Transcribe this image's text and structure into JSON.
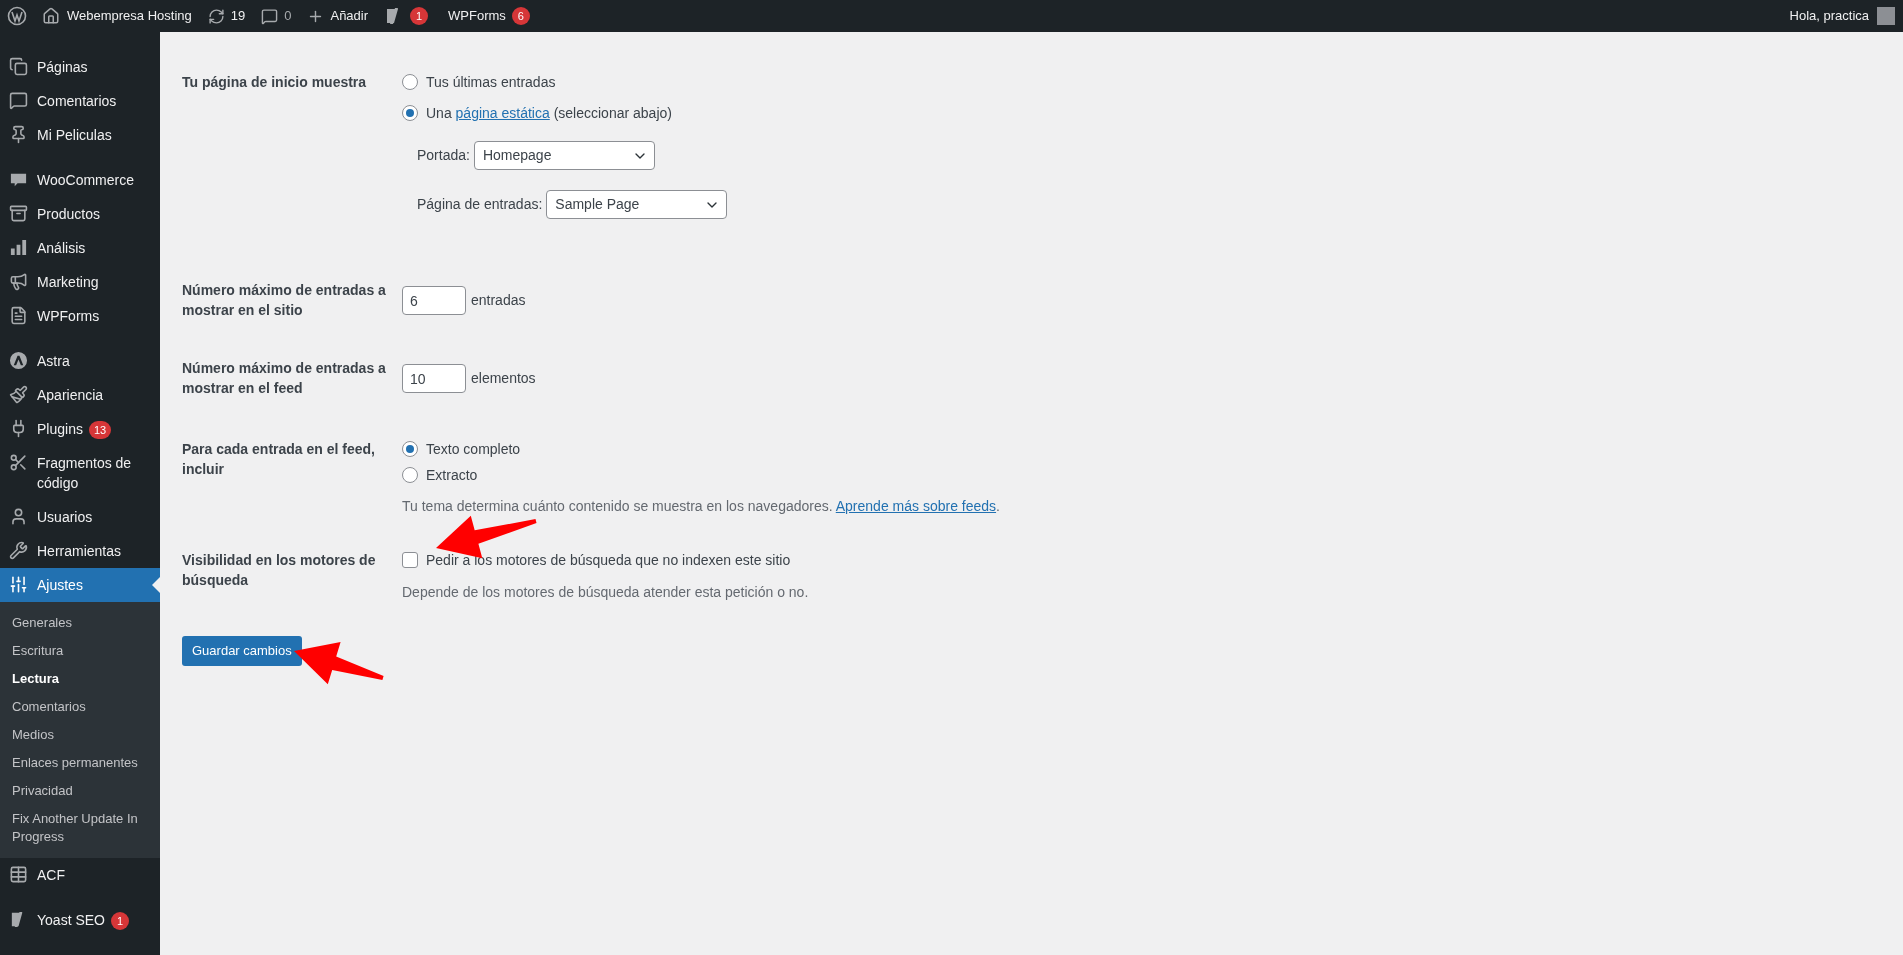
{
  "admin_bar": {
    "site": "Webempresa Hosting",
    "updates": "19",
    "comments": "0",
    "new": "Añadir",
    "yoast_badge": "1",
    "wpforms": {
      "label": "WPForms",
      "badge": "6"
    },
    "greeting": "Hola, practica"
  },
  "sidebar": {
    "groups": [
      [
        {
          "label": "Páginas",
          "selected": false
        },
        {
          "label": "Comentarios",
          "selected": false
        },
        {
          "label": "Mi Peliculas",
          "selected": false
        }
      ],
      [
        {
          "label": "WooCommerce",
          "selected": false
        },
        {
          "label": "Productos",
          "selected": false
        },
        {
          "label": "Análisis",
          "selected": false
        },
        {
          "label": "Marketing",
          "selected": false
        },
        {
          "label": "WPForms",
          "selected": false
        }
      ],
      [
        {
          "label": "Astra",
          "selected": false
        },
        {
          "label": "Apariencia",
          "selected": false
        },
        {
          "label": "Plugins",
          "selected": false,
          "badge": "13"
        },
        {
          "label": "Fragmentos de código",
          "selected": false
        },
        {
          "label": "Usuarios",
          "selected": false
        },
        {
          "label": "Herramientas",
          "selected": false
        },
        {
          "label": "Ajustes",
          "selected": true,
          "children": [
            {
              "label": "Generales",
              "selected": false
            },
            {
              "label": "Escritura",
              "selected": false
            },
            {
              "label": "Lectura",
              "selected": true
            },
            {
              "label": "Comentarios",
              "selected": false
            },
            {
              "label": "Medios",
              "selected": false
            },
            {
              "label": "Enlaces permanentes",
              "selected": false
            },
            {
              "label": "Privacidad",
              "selected": false
            },
            {
              "label": "Fix Another Update In Progress",
              "selected": false
            }
          ]
        },
        {
          "label": "ACF",
          "selected": false
        }
      ],
      [
        {
          "label": "Yoast SEO",
          "selected": false,
          "badge": "1"
        }
      ]
    ]
  },
  "settings": [
    {
      "kind": "radio",
      "label": "Tu página de inicio muestra",
      "options": [
        {
          "text": "Tus últimas entradas",
          "selected": false
        },
        {
          "text": "Una ",
          "link": "página estática",
          "after": " (seleccionar abajo)",
          "selected": true
        }
      ],
      "selects": [
        {
          "label": "Portada:",
          "value": "Homepage"
        },
        {
          "label": "Página de entradas:",
          "value": "Sample Page"
        }
      ]
    },
    {
      "kind": "number",
      "label": "Número máximo de entradas a mostrar en el sitio",
      "value": "6",
      "unit": "entradas"
    },
    {
      "kind": "number",
      "label": "Número máximo de entradas a mostrar en el feed",
      "value": "10",
      "unit": "elementos"
    },
    {
      "kind": "radio",
      "label": "Para cada entrada en el feed, incluir",
      "options": [
        {
          "text": "Texto completo",
          "selected": true
        },
        {
          "text": "Extracto",
          "selected": false
        }
      ],
      "description": {
        "text": "Tu tema determina cuánto contenido se muestra en los navegadores. ",
        "link": "Aprende más sobre feeds",
        "after": "."
      }
    },
    {
      "kind": "checkbox",
      "label": "Visibilidad en los motores de búsqueda",
      "text": "Pedir a los motores de búsqueda que no indexen este sitio",
      "checked": false,
      "description": {
        "text": "Depende de los motores de búsqueda atender esta petición o no."
      }
    }
  ],
  "save_button": "Guardar cambios"
}
